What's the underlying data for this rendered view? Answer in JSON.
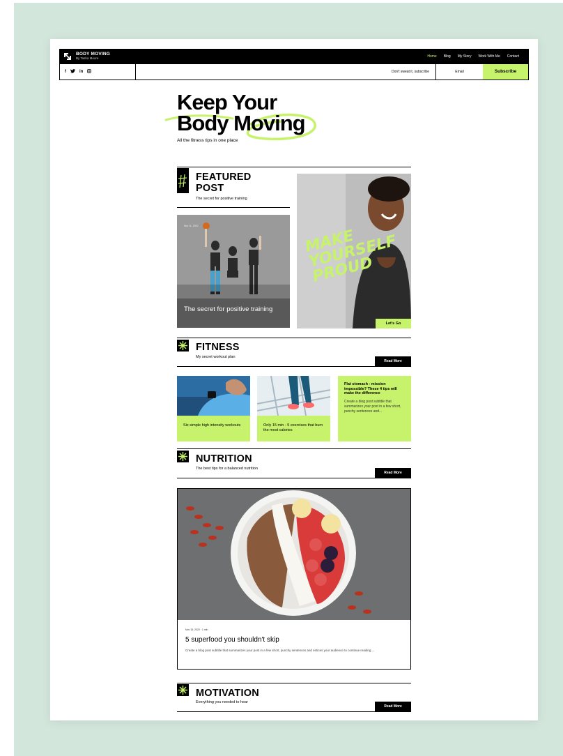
{
  "header": {
    "brand_name": "BODY MOVING",
    "brand_by": "By Tasha Moore",
    "nav": [
      {
        "label": "Home",
        "active": true
      },
      {
        "label": "Blog",
        "active": false
      },
      {
        "label": "My Story",
        "active": false
      },
      {
        "label": "Work With Me",
        "active": false
      },
      {
        "label": "Contact",
        "active": false
      }
    ]
  },
  "subbar": {
    "social": [
      "facebook-icon",
      "twitter-icon",
      "linkedin-icon",
      "instagram-icon"
    ],
    "social_glyphs": [
      "f",
      "❦",
      "in",
      "◎"
    ],
    "subscribe_prompt": "Don't sweat it, subscribe",
    "email_placeholder": "Email",
    "subscribe_label": "Subscribe"
  },
  "hero": {
    "line1": "Keep Your",
    "line2": "Body Moving",
    "tagline": "All the fitness tips in one place"
  },
  "featured": {
    "title_line1": "FEATURED",
    "title_line2": "POST",
    "subtitle": "The secret for positive training",
    "post_date": "Nov 11, 2020",
    "post_caption": "The secret for positive training",
    "promo_text": "MAKE YOURSELF PROUD",
    "promo_button": "Let's Go"
  },
  "fitness": {
    "title": "FITNESS",
    "subtitle": "My secret workout plan",
    "read_more": "Read More",
    "cards": [
      {
        "caption": "Six simple high intensity workouts"
      },
      {
        "caption": "Only 15 min - 5 exercises that burn the most calories"
      },
      {
        "title": "Flat stomach - mission impossible? These 4 tips will make the difference",
        "excerpt": "Create a blog post subtitle that summarizes your post in a few short, punchy sentences and..."
      }
    ]
  },
  "nutrition": {
    "title": "NUTRITION",
    "subtitle": "The best tips for a balanced nutrition",
    "read_more": "Read More",
    "post_meta": "Nov 15, 2020 · 1 min",
    "post_title": "5 superfood you shouldn't skip",
    "post_excerpt": "Create a blog post subtitle that summarizes your post in a few short, punchy sentences and entices your audience to continue reading...."
  },
  "motivation": {
    "title": "MOTIVATION",
    "subtitle": "Everything you needed to hear",
    "read_more": "Read More"
  },
  "colors": {
    "accent": "#c7f26b",
    "background_mat": "#d3e6dc",
    "dark": "#000000"
  }
}
